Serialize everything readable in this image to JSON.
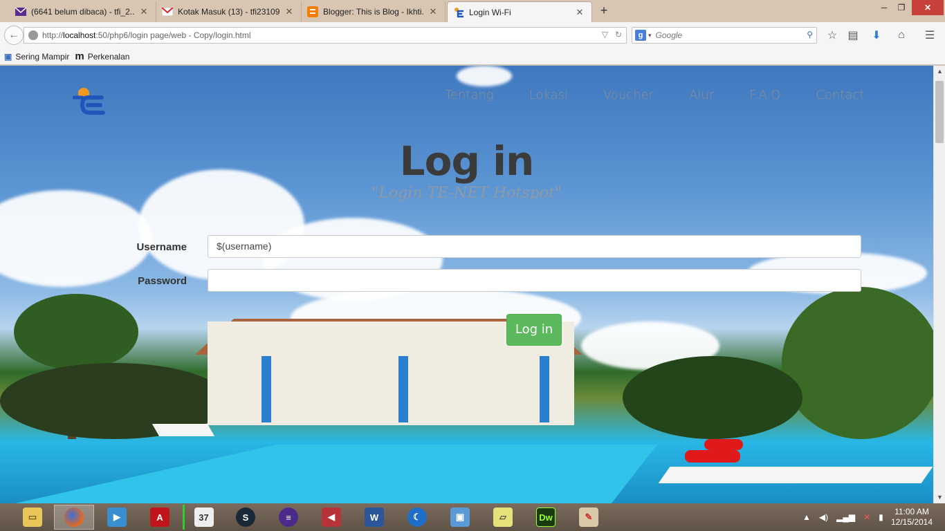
{
  "browser": {
    "tabs": [
      {
        "label": "(6641 belum dibaca) - tfi_2...",
        "icon": "yahoo-mail-icon"
      },
      {
        "label": "Kotak Masuk (13) - tfi23109...",
        "icon": "gmail-icon"
      },
      {
        "label": "Blogger: This is Blog - Ikhti...",
        "icon": "blogger-icon"
      },
      {
        "label": "Login Wi-Fi",
        "icon": "te-net-icon"
      }
    ],
    "new_tab": "+",
    "url_prefix": "http://",
    "url_host": "localhost",
    "url_rest": ":50/php6/login page/web - Copy/login.html",
    "search_placeholder": "Google",
    "bookmarks": [
      {
        "label": "Sering Mampir",
        "icon": "bookmark-page-icon"
      },
      {
        "label": "Perkenalan",
        "icon": "m-icon"
      }
    ]
  },
  "page": {
    "nav": [
      "Tentang",
      "Lokasi",
      "Voucher",
      "Alur",
      "F.A.Q",
      "Contact"
    ],
    "title": "Log in",
    "subtitle": "\"Login TE-NET Hotspot\"",
    "form": {
      "username_label": "Username",
      "username_value": "$(username)",
      "password_label": "Password",
      "password_value": "",
      "submit_label": "Log in"
    },
    "colors": {
      "accent": "#5cb85c",
      "logo_blue": "#1f56b8",
      "logo_orange": "#f39a1e"
    }
  },
  "taskbar": {
    "apps": [
      "file-explorer-icon",
      "firefox-icon",
      "media-player-icon",
      "acrobat-icon",
      "calendar-icon",
      "steam-icon",
      "eclipse-icon",
      "app-red-icon",
      "word-icon",
      "app-blue-icon",
      "virtualbox-icon",
      "sticky-notes-icon",
      "dreamweaver-icon",
      "paint-icon"
    ],
    "time": "11:00 AM",
    "date": "12/15/2014"
  }
}
